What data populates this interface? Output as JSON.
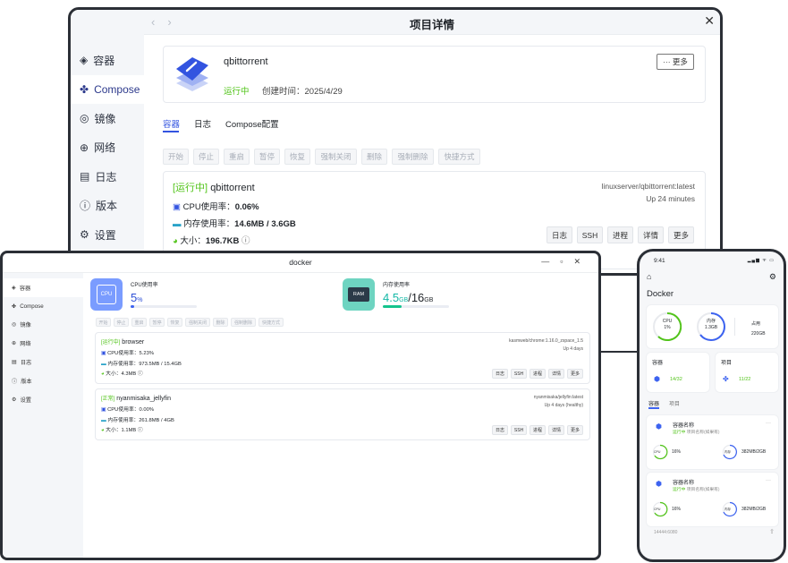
{
  "detail": {
    "title": "项目详情",
    "sidebar": [
      {
        "icon": "cube-icon",
        "label": "容器"
      },
      {
        "icon": "compose-icon",
        "label": "Compose"
      },
      {
        "icon": "image-icon",
        "label": "镜像"
      },
      {
        "icon": "network-icon",
        "label": "网络"
      },
      {
        "icon": "log-icon",
        "label": "日志"
      },
      {
        "icon": "info-icon",
        "label": "版本"
      },
      {
        "icon": "gear-icon",
        "label": "设置"
      }
    ],
    "app_name": "qbittorrent",
    "status": "运行中",
    "created": "创建时间：2025/4/29",
    "more": "··· 更多",
    "tabs": [
      "容器",
      "日志",
      "Compose配置"
    ],
    "actions": [
      "开始",
      "停止",
      "重启",
      "暂停",
      "恢复",
      "强制关闭",
      "删除",
      "强制删除",
      "快捷方式"
    ],
    "container": {
      "state": "[运行中]",
      "name": "qbittorrent",
      "image": "linuxserver/qbittorrent:latest",
      "uptime": "Up 24 minutes",
      "cpu_label": "CPU使用率：",
      "cpu": "0.06%",
      "mem_label": "内存使用率：",
      "mem": "14.6MB / 3.6GB",
      "size_label": "大小：",
      "size": "196.7KB",
      "buttons": [
        "日志",
        "SSH",
        "进程",
        "详情",
        "更多"
      ]
    }
  },
  "docker": {
    "title": "docker",
    "controls": [
      "—",
      "▫",
      "✕"
    ],
    "sidebar": [
      {
        "icon": "cube-icon",
        "label": "容器"
      },
      {
        "icon": "compose-icon",
        "label": "Compose"
      },
      {
        "icon": "image-icon",
        "label": "镜像"
      },
      {
        "icon": "network-icon",
        "label": "网络"
      },
      {
        "icon": "log-icon",
        "label": "日志"
      },
      {
        "icon": "info-icon",
        "label": "版本"
      },
      {
        "icon": "gear-icon",
        "label": "设置"
      }
    ],
    "cpu": {
      "label": "CPU使用率",
      "value": "5",
      "unit": "%",
      "chip": "CPU",
      "fill": 0.05
    },
    "mem": {
      "label": "内存使用率",
      "used": "4.5",
      "used_unit": "GB",
      "sep": "/",
      "total": "16",
      "total_unit": "GB",
      "chip": "RAM",
      "fill": 0.28
    },
    "actions": [
      "开始",
      "停止",
      "重启",
      "暂停",
      "恢复",
      "强制关闭",
      "删除",
      "强制删除",
      "快捷方式"
    ],
    "containers": [
      {
        "state": "[运行中]",
        "name": "browser",
        "image": "kasmweb/chrome:1.16.0_zspace_1.5",
        "uptime": "Up 4 days",
        "cpu": "CPU使用率：5.23%",
        "mem": "内存使用率：973.5MB / 15.4GB",
        "size": "大小：4.3MB",
        "buttons": [
          "日志",
          "SSH",
          "进程",
          "详情",
          "更多"
        ]
      },
      {
        "state": "[正常]",
        "name": "nyanmisaka_jellyfin",
        "image": "nyanmisaka/jellyfin:latest",
        "uptime": "Up 4 days (healthy)",
        "cpu": "CPU使用率：0.00%",
        "mem": "内存使用率：261.8MB / 4GB",
        "size": "大小：1.1MB",
        "buttons": [
          "日志",
          "SSH",
          "进程",
          "详情",
          "更多"
        ]
      }
    ]
  },
  "phone": {
    "time": "9:41",
    "status_icons": "▂▄▆ ᯤ ▭",
    "title": "Docker",
    "cpu_label": "CPU",
    "cpu_value": "1%",
    "mem_label": "内存",
    "mem_value": "1.3GB",
    "used_label": "占用",
    "used_value": "220GB",
    "containers_label": "容器",
    "containers_value": "14/32",
    "projects_label": "项目",
    "projects_value": "11/22",
    "tabs": [
      "容器",
      "项目"
    ],
    "items": [
      {
        "name": "容器名称",
        "status": "运行中",
        "project": "项目名称(如果有)",
        "cpu_chip": "CPU",
        "cpu": "16%",
        "mem_chip": "内存",
        "mem": "382MB/2GB"
      },
      {
        "name": "容器名称",
        "status": "运行中",
        "project": "项目名称(如果有)",
        "cpu_chip": "CPU",
        "cpu": "16%",
        "mem_chip": "内存",
        "mem": "382MB/2GB"
      }
    ],
    "footer": "14444:6080"
  }
}
